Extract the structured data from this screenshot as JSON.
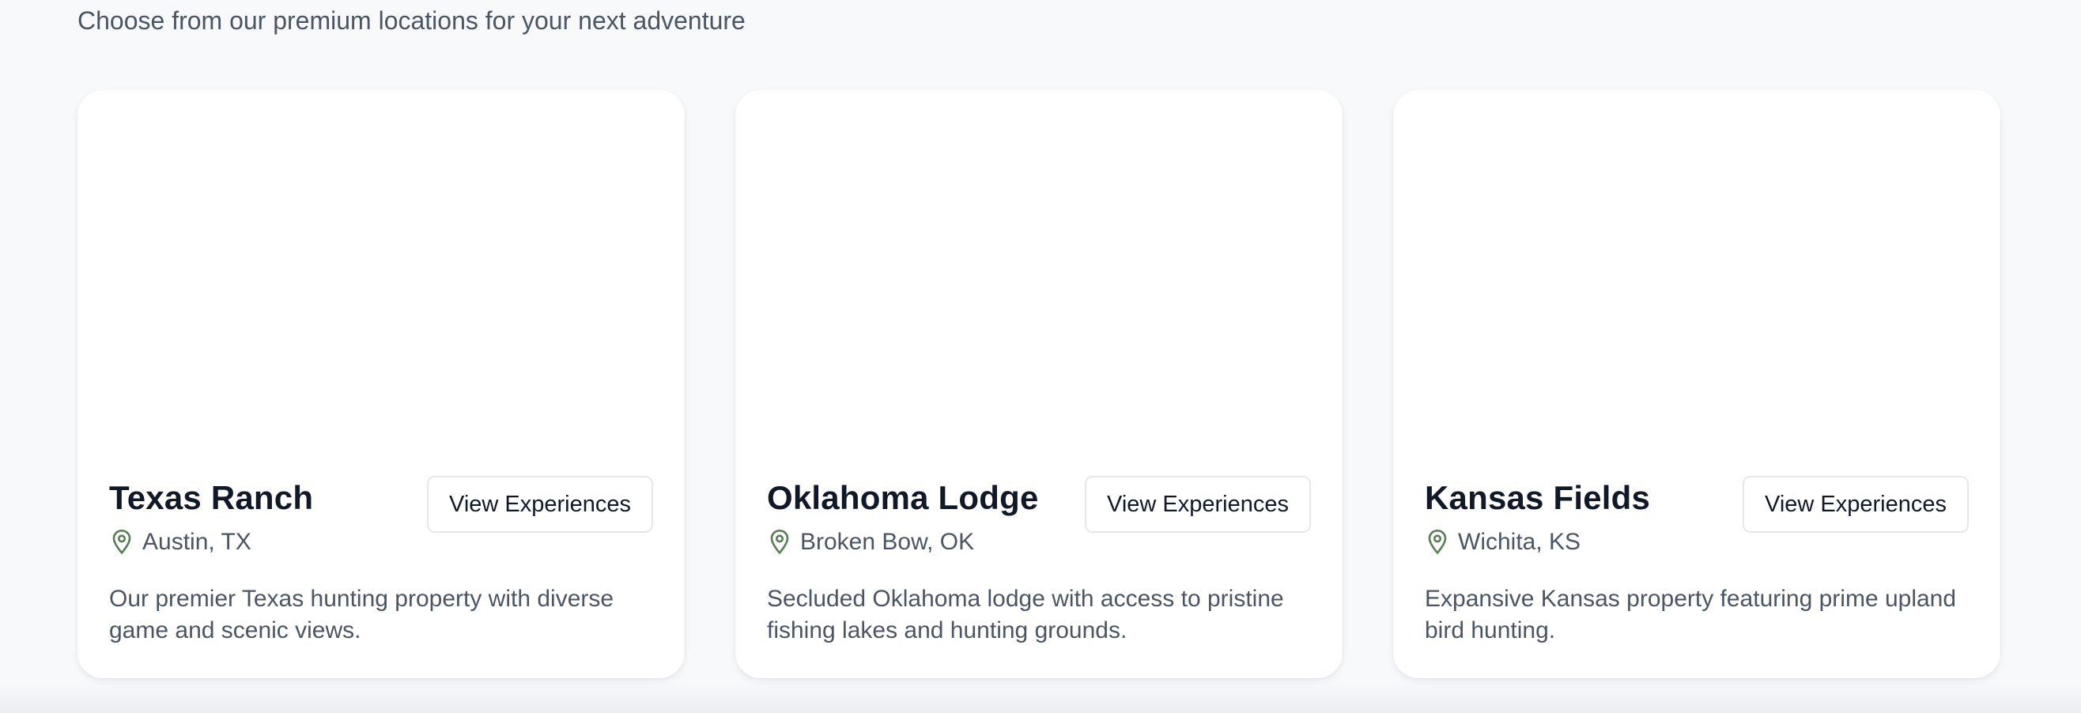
{
  "header": {
    "subtitle": "Choose from our premium locations for your next adventure"
  },
  "accent_color": "#5a7f57",
  "locations": [
    {
      "name": "Texas Ranch",
      "location": "Austin, TX",
      "description": "Our premier Texas hunting property with diverse game and scenic views.",
      "button_label": "View Experiences"
    },
    {
      "name": "Oklahoma Lodge",
      "location": "Broken Bow, OK",
      "description": "Secluded Oklahoma lodge with access to pristine fishing lakes and hunting grounds.",
      "button_label": "View Experiences"
    },
    {
      "name": "Kansas Fields",
      "location": "Wichita, KS",
      "description": "Expansive Kansas property featuring prime upland bird hunting.",
      "button_label": "View Experiences"
    }
  ]
}
